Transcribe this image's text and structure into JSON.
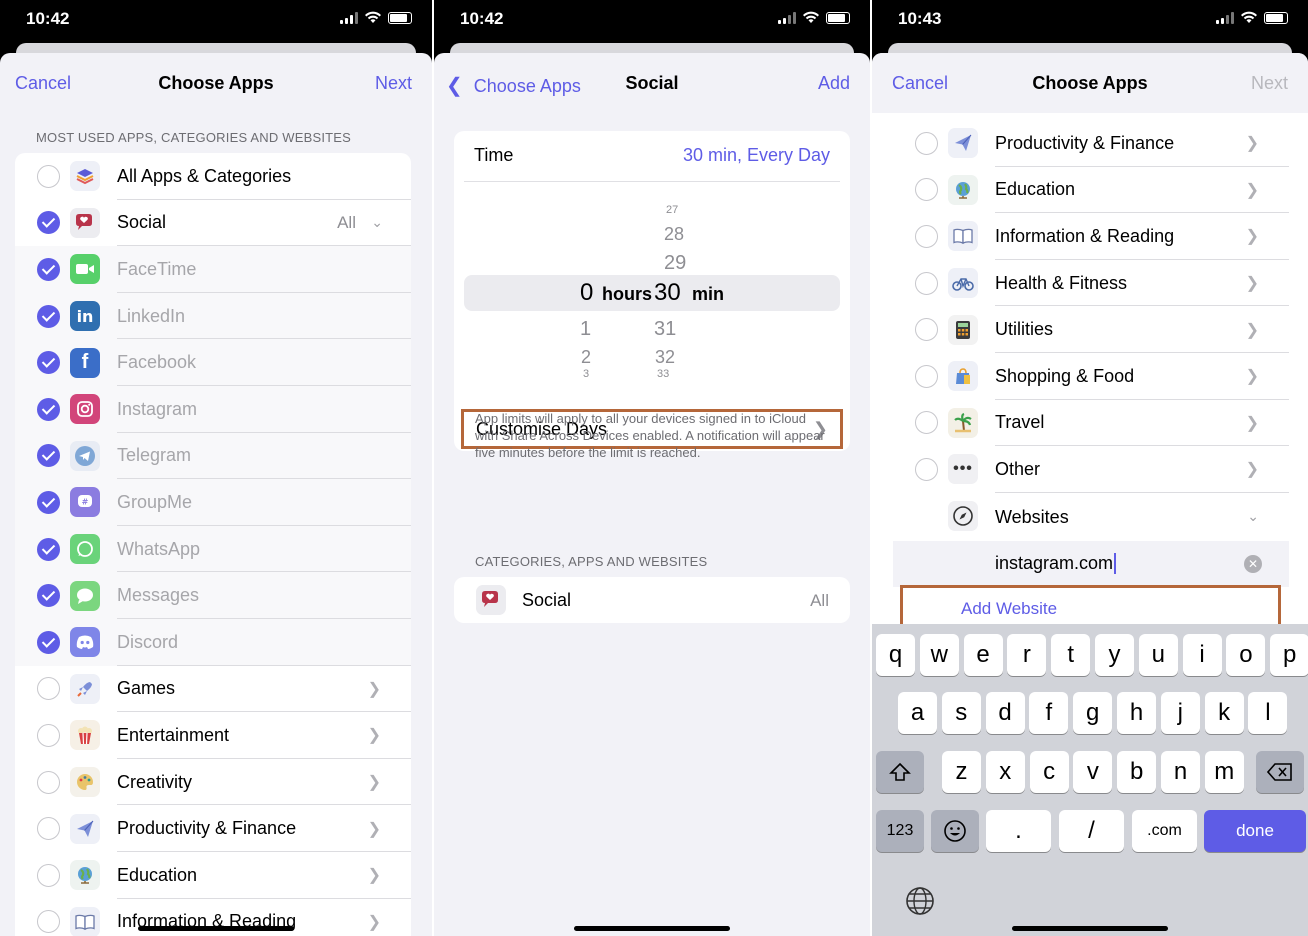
{
  "panel1": {
    "status": {
      "time": "10:42"
    },
    "nav": {
      "left": "Cancel",
      "title": "Choose Apps",
      "right": "Next"
    },
    "section": "MOST USED APPS, CATEGORIES AND WEBSITES",
    "rows": [
      {
        "label": "All Apps & Categories",
        "checked": false,
        "icon": "stack-icon",
        "dim": false
      },
      {
        "label": "Social",
        "checked": true,
        "icon": "social-icon",
        "dim": false,
        "trail": "All"
      },
      {
        "label": "FaceTime",
        "checked": true,
        "icon": "facetime-icon",
        "dim": true
      },
      {
        "label": "LinkedIn",
        "checked": true,
        "icon": "linkedin-icon",
        "dim": true
      },
      {
        "label": "Facebook",
        "checked": true,
        "icon": "facebook-icon",
        "dim": true
      },
      {
        "label": "Instagram",
        "checked": true,
        "icon": "instagram-icon",
        "dim": true
      },
      {
        "label": "Telegram",
        "checked": true,
        "icon": "telegram-icon",
        "dim": true
      },
      {
        "label": "GroupMe",
        "checked": true,
        "icon": "groupme-icon",
        "dim": true
      },
      {
        "label": "WhatsApp",
        "checked": true,
        "icon": "whatsapp-icon",
        "dim": true
      },
      {
        "label": "Messages",
        "checked": true,
        "icon": "messages-icon",
        "dim": true
      },
      {
        "label": "Discord",
        "checked": true,
        "icon": "discord-icon",
        "dim": true
      },
      {
        "label": "Games",
        "checked": false,
        "icon": "rocket-icon",
        "dim": false
      },
      {
        "label": "Entertainment",
        "checked": false,
        "icon": "popcorn-icon",
        "dim": false
      },
      {
        "label": "Creativity",
        "checked": false,
        "icon": "palette-icon",
        "dim": false
      },
      {
        "label": "Productivity & Finance",
        "checked": false,
        "icon": "paperplane-icon",
        "dim": false
      },
      {
        "label": "Education",
        "checked": false,
        "icon": "globe-icon",
        "dim": false
      },
      {
        "label": "Information & Reading",
        "checked": false,
        "icon": "book-icon",
        "dim": false
      }
    ]
  },
  "panel2": {
    "status": {
      "time": "10:42"
    },
    "nav": {
      "left": "Choose Apps",
      "title": "Social",
      "right": "Add"
    },
    "time_label": "Time",
    "time_value": "30 min, Every Day",
    "picker": {
      "hours_above": [
        "",
        ""
      ],
      "hours_selected": "0",
      "hours_unit": "hours",
      "hours_below": [
        "1",
        "2",
        "3"
      ],
      "min_above": [
        "27",
        "28",
        "29"
      ],
      "min_selected": "30",
      "min_unit": "min",
      "min_below": [
        "31",
        "32",
        "33"
      ]
    },
    "customise": "Customise Days",
    "note": "App limits will apply to all your devices signed in to iCloud with Share Across Devices enabled. A notification will appear five minutes before the limit is reached.",
    "section": "CATEGORIES, APPS AND WEBSITES",
    "social_label": "Social",
    "social_trail": "All"
  },
  "panel3": {
    "status": {
      "time": "10:43"
    },
    "nav": {
      "left": "Cancel",
      "title": "Choose Apps",
      "right": "Next"
    },
    "rows": [
      {
        "label": "Productivity & Finance",
        "icon": "paperplane-icon"
      },
      {
        "label": "Education",
        "icon": "globe-icon"
      },
      {
        "label": "Information & Reading",
        "icon": "book-icon"
      },
      {
        "label": "Health & Fitness",
        "icon": "bicycle-icon"
      },
      {
        "label": "Utilities",
        "icon": "calculator-icon"
      },
      {
        "label": "Shopping & Food",
        "icon": "bag-icon"
      },
      {
        "label": "Travel",
        "icon": "palm-icon"
      },
      {
        "label": "Other",
        "icon": "ellipsis-icon"
      }
    ],
    "websites_label": "Websites",
    "website_value": "instagram.com",
    "add_website": "Add Website",
    "keyboard": {
      "row1": [
        "q",
        "w",
        "e",
        "r",
        "t",
        "y",
        "u",
        "i",
        "o",
        "p"
      ],
      "row2": [
        "a",
        "s",
        "d",
        "f",
        "g",
        "h",
        "j",
        "k",
        "l"
      ],
      "row3": [
        "z",
        "x",
        "c",
        "v",
        "b",
        "n",
        "m"
      ],
      "k123": "123",
      "dot": ".",
      "slash": "/",
      "dotcom": ".com",
      "done": "done"
    }
  },
  "colors": {
    "accent": "#5e5ce6",
    "highlight_box": "#b5673a"
  }
}
